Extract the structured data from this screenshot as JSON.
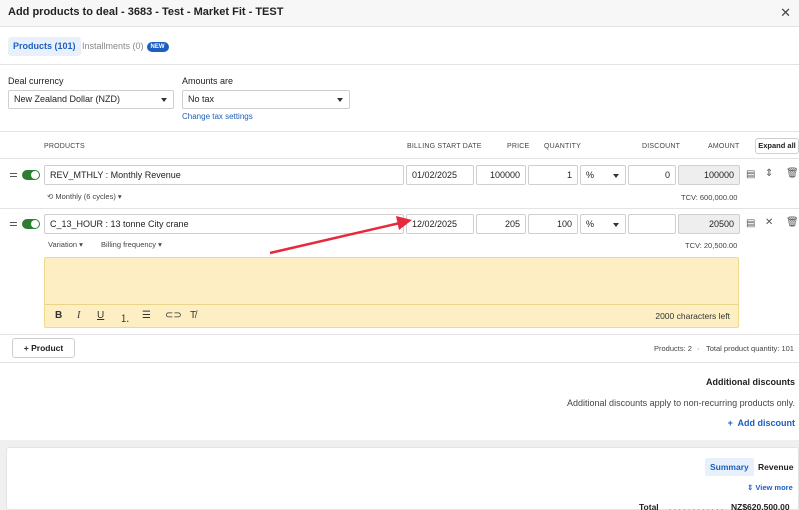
{
  "header": {
    "title": "Add products to deal - 3683 - Test - Market Fit - TEST"
  },
  "tabs": {
    "products": "Products (101)",
    "installments": "Installments (0)",
    "new_badge": "NEW"
  },
  "settings": {
    "currency_label": "Deal currency",
    "currency_value": "New Zealand Dollar (NZD)",
    "amounts_label": "Amounts are",
    "amounts_value": "No tax",
    "tax_link": "Change tax settings"
  },
  "columns": {
    "products": "PRODUCTS",
    "billing_start": "BILLING START DATE",
    "price": "PRICE",
    "quantity": "QUANTITY",
    "discount": "DISCOUNT",
    "amount": "AMOUNT",
    "expand_all": "Expand all"
  },
  "rows": [
    {
      "product": "REV_MTHLY : Monthly Revenue",
      "billing_start": "01/02/2025",
      "price": "100000",
      "quantity": "1",
      "discount_type": "%",
      "discount": "0",
      "amount": "100000",
      "recurrence": "Monthly (6 cycles)",
      "tcv": "TCV: 600,000.00"
    },
    {
      "product": "C_13_HOUR : 13 tonne City crane",
      "billing_start": "12/02/2025",
      "price": "205",
      "quantity": "100",
      "discount_type": "%",
      "discount": "",
      "amount": "20500",
      "variation": "Variation",
      "billing_frequency": "Billing frequency",
      "tcv": "TCV: 20,500.00",
      "chars_left": "2000 characters left"
    }
  ],
  "footer_bar": {
    "add_product": "Product",
    "products_count": "Products: 2",
    "total_quantity": "Total product quantity: 101"
  },
  "additional_discounts": {
    "title": "Additional discounts",
    "note": "Additional discounts apply to non-recurring products only.",
    "add_link": "Add discount"
  },
  "summary": {
    "tab_summary": "Summary",
    "tab_revenue": "Revenue",
    "view_more": "View more",
    "total_label": "Total",
    "total_value": "NZ$620,500.00"
  },
  "colors": {
    "accent": "#1d5fbf",
    "toggle_on": "#2e7d32",
    "editor_bg": "#fdefc3",
    "arrow": "#e8283c"
  }
}
